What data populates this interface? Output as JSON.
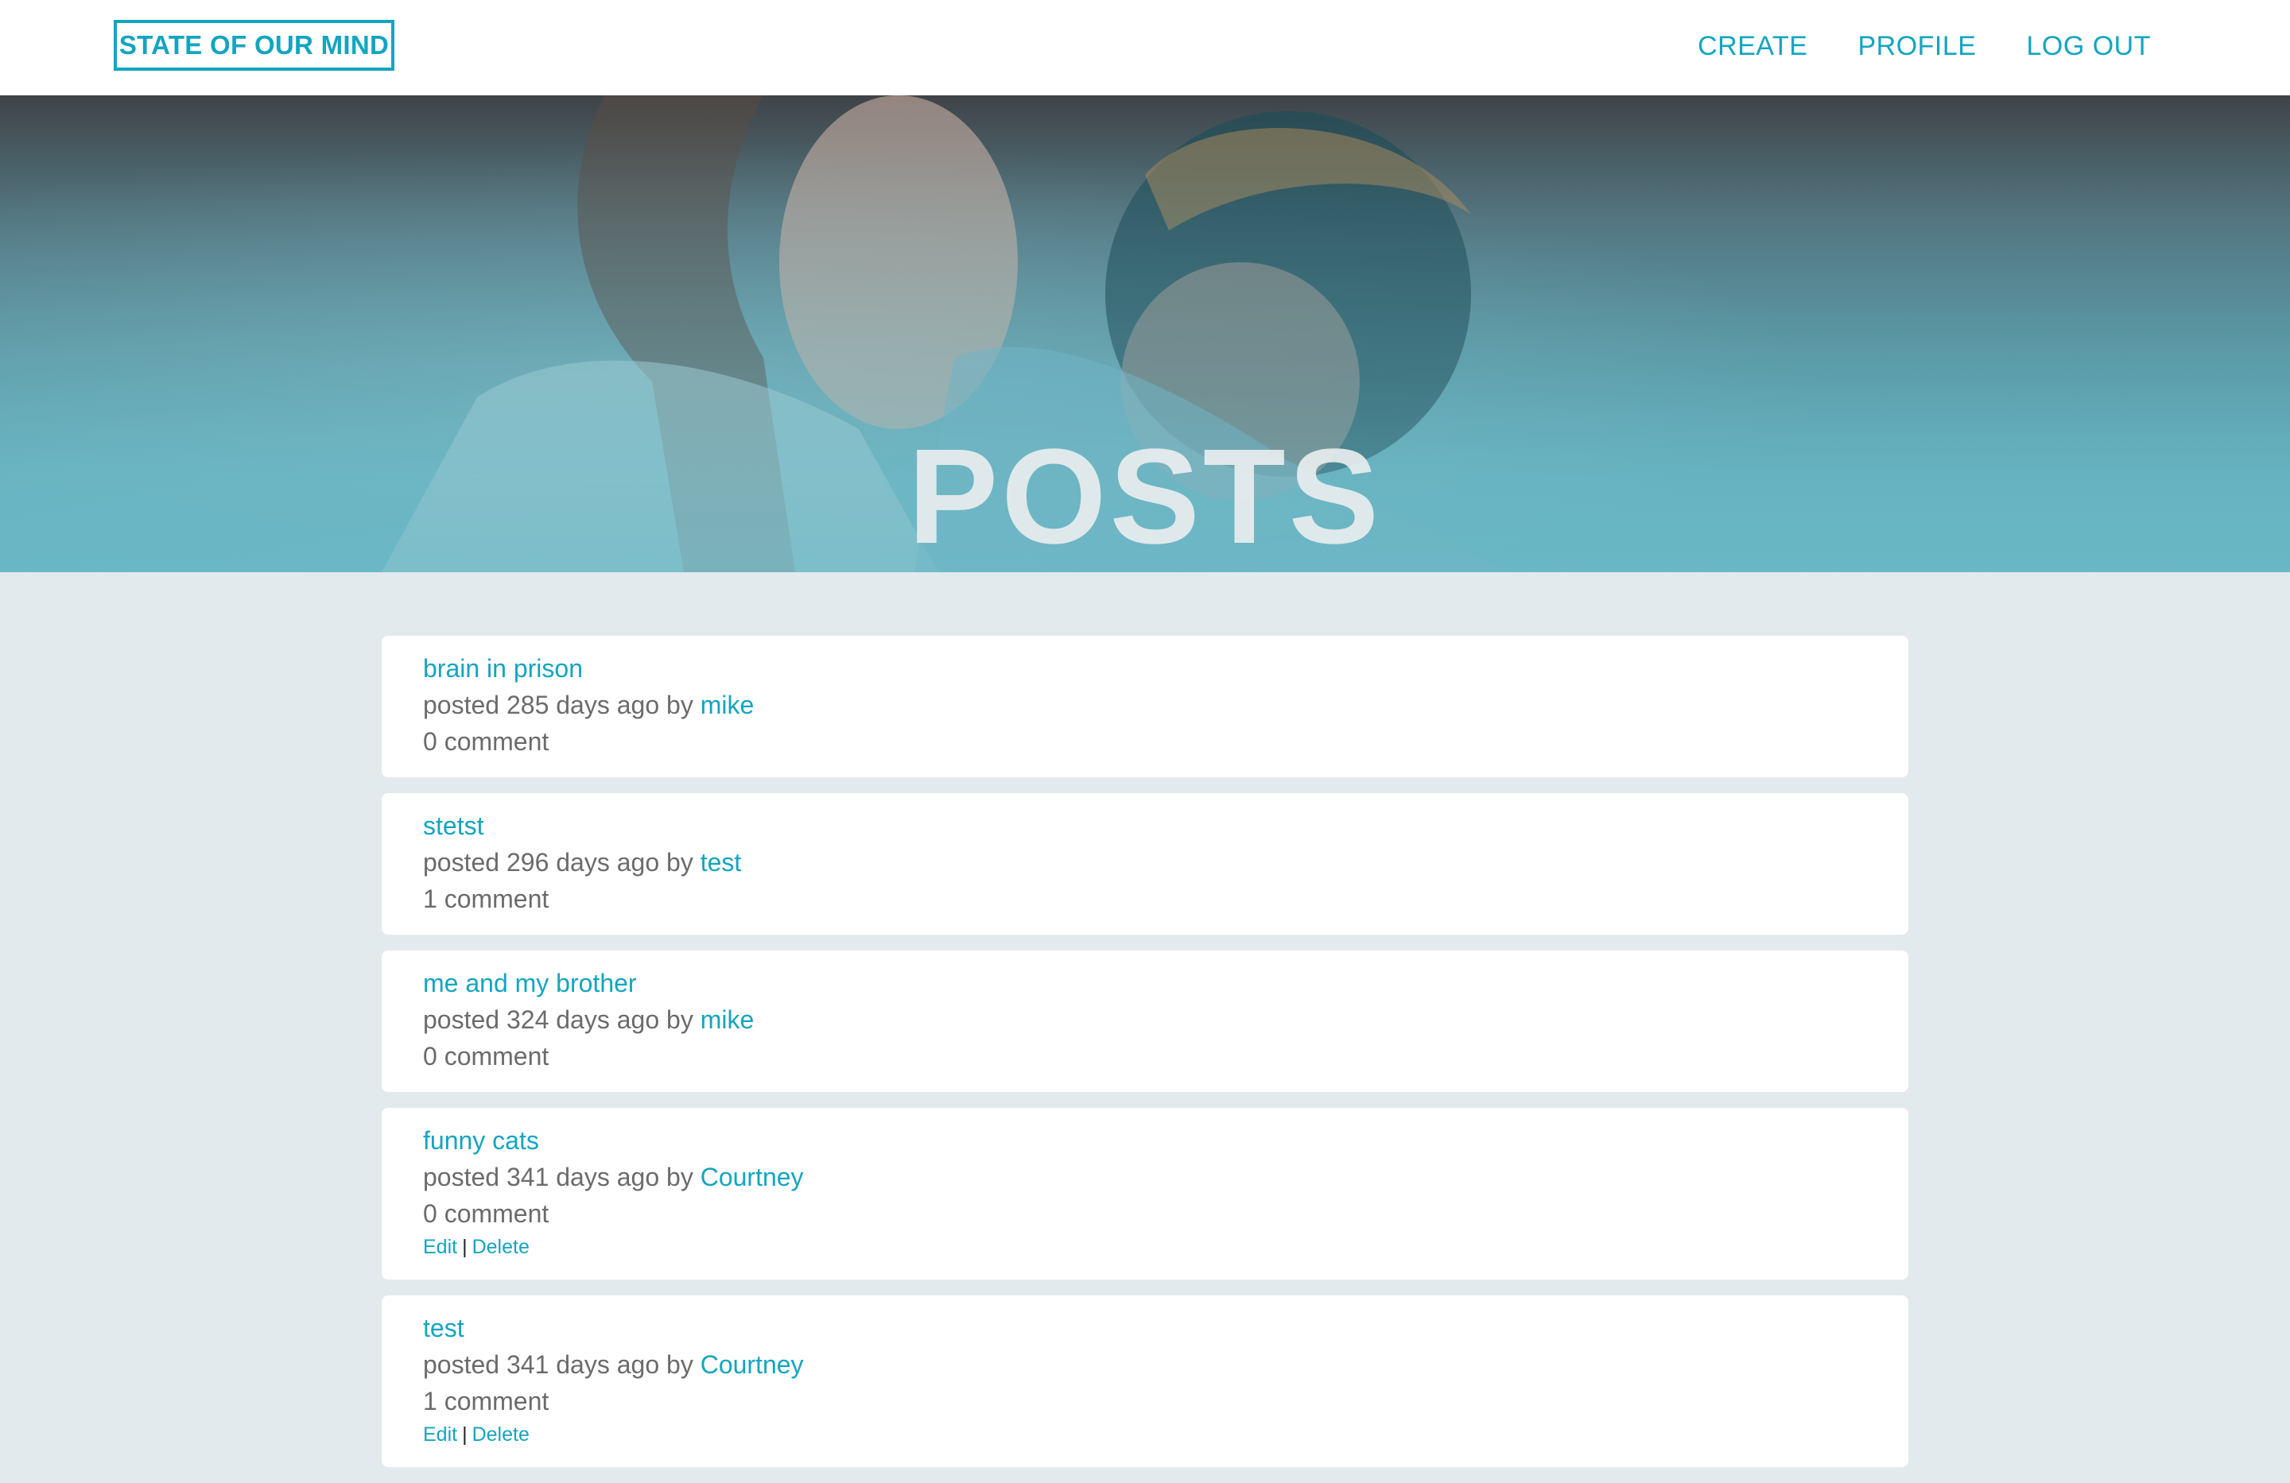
{
  "brand": "STATE OF OUR MIND",
  "nav": {
    "create": "CREATE",
    "profile": "PROFILE",
    "logout": "LOG OUT"
  },
  "hero": {
    "title": "POSTS"
  },
  "colors": {
    "accent": "#13a5c0",
    "page_bg": "#e3eaed",
    "card_bg": "#ffffff",
    "muted_text": "#6b6b6b"
  },
  "posts": [
    {
      "title": "brain in prison",
      "meta_prefix": "posted 285 days ago by",
      "author": "mike",
      "comments": "0 comment"
    },
    {
      "title": "stetst",
      "meta_prefix": "posted 296 days ago by",
      "author": "test",
      "comments": "1 comment"
    },
    {
      "title": "me and my brother",
      "meta_prefix": "posted 324 days ago by",
      "author": "mike",
      "comments": "0 comment"
    },
    {
      "title": "funny cats",
      "meta_prefix": "posted 341 days ago by",
      "author": "Courtney",
      "comments": "0 comment",
      "edit": "Edit",
      "sep": "|",
      "delete": "Delete"
    },
    {
      "title": "test",
      "meta_prefix": "posted 341 days ago by",
      "author": "Courtney",
      "comments": "1 comment",
      "edit": "Edit",
      "sep": "|",
      "delete": "Delete"
    }
  ]
}
